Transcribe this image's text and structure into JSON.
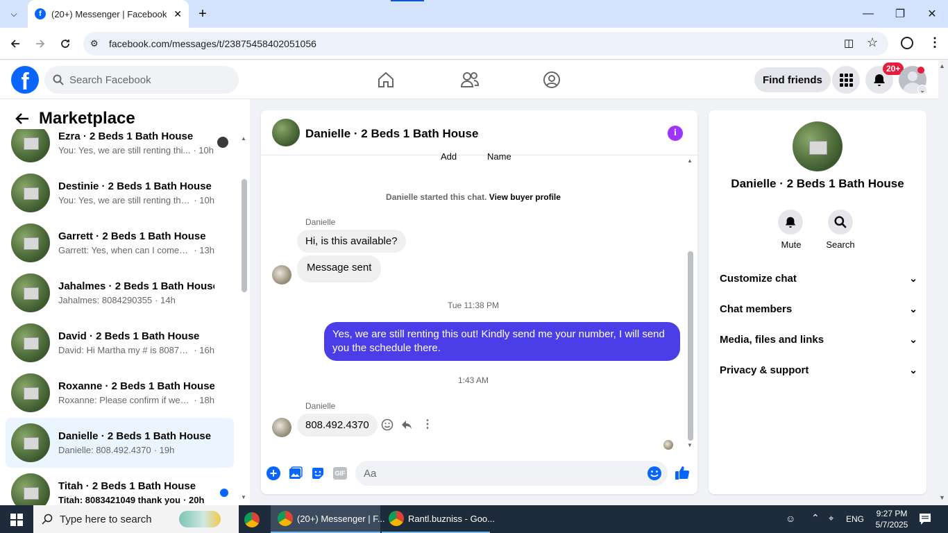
{
  "browser": {
    "tab_title": "(20+) Messenger | Facebook",
    "url": "facebook.com/messages/t/23875458402051056"
  },
  "fb": {
    "search_placeholder": "Search Facebook",
    "find_friends": "Find friends",
    "notif_badge": "20+"
  },
  "sidebar": {
    "title": "Marketplace",
    "conversations": [
      {
        "name": "Ezra · 2 Beds 1 Bath House",
        "preview": "You: Yes, we are still renting thi...",
        "time": "· 10h"
      },
      {
        "name": "Destinie · 2 Beds 1 Bath House",
        "preview": "You: Yes, we are still renting this o...",
        "time": "· 10h"
      },
      {
        "name": "Garrett · 2 Beds 1 Bath House",
        "preview": "Garrett: Yes, when can I come? Ta...",
        "time": "· 13h"
      },
      {
        "name": "Jahalmes · 2 Beds 1 Bath House",
        "preview": "Jahalmes: 8084290355",
        "time": "· 14h"
      },
      {
        "name": "David · 2 Beds 1 Bath House",
        "preview": "David: Hi Martha my # is 8087835...",
        "time": "· 16h"
      },
      {
        "name": "Roxanne · 2 Beds 1 Bath House",
        "preview": "Roxanne: Please confirm if we hav...",
        "time": "· 18h"
      },
      {
        "name": "Danielle · 2 Beds 1 Bath House",
        "preview": "Danielle: 808.492.4370",
        "time": "· 19h"
      },
      {
        "name": "Titah · 2 Beds 1 Bath House",
        "preview": "Titah: 8083421049 thank you",
        "time": "· 20h"
      }
    ]
  },
  "chat": {
    "title": "Danielle · 2 Beds 1 Bath House",
    "top_cut_add": "Add",
    "top_cut_name": "Name",
    "started": "Danielle started this chat.",
    "view_profile": "View buyer profile",
    "sender": "Danielle",
    "msg1": "Hi, is this available?",
    "msg2": "Message sent",
    "time1": "Tue 11:38 PM",
    "outgoing": "Yes, we are still renting this out! Kindly send me your number, I will send you the schedule there.",
    "time2": "1:43 AM",
    "sender2": "Danielle",
    "msg3": "808.492.4370",
    "composer_placeholder": "Aa"
  },
  "info": {
    "title": "Danielle · 2 Beds 1 Bath House",
    "mute": "Mute",
    "search": "Search",
    "sections": [
      "Customize chat",
      "Chat members",
      "Media, files and links",
      "Privacy & support"
    ]
  },
  "taskbar": {
    "search": "Type here to search",
    "app1": "(20+) Messenger | F...",
    "app2": "Rantl.buzniss - Goo...",
    "lang": "ENG",
    "time": "9:27 PM",
    "date": "5/7/2025"
  },
  "colors": {
    "accent": "#0866ff",
    "outgoing_bubble": "#4b3ee8",
    "info_icon": "#a033ff"
  }
}
